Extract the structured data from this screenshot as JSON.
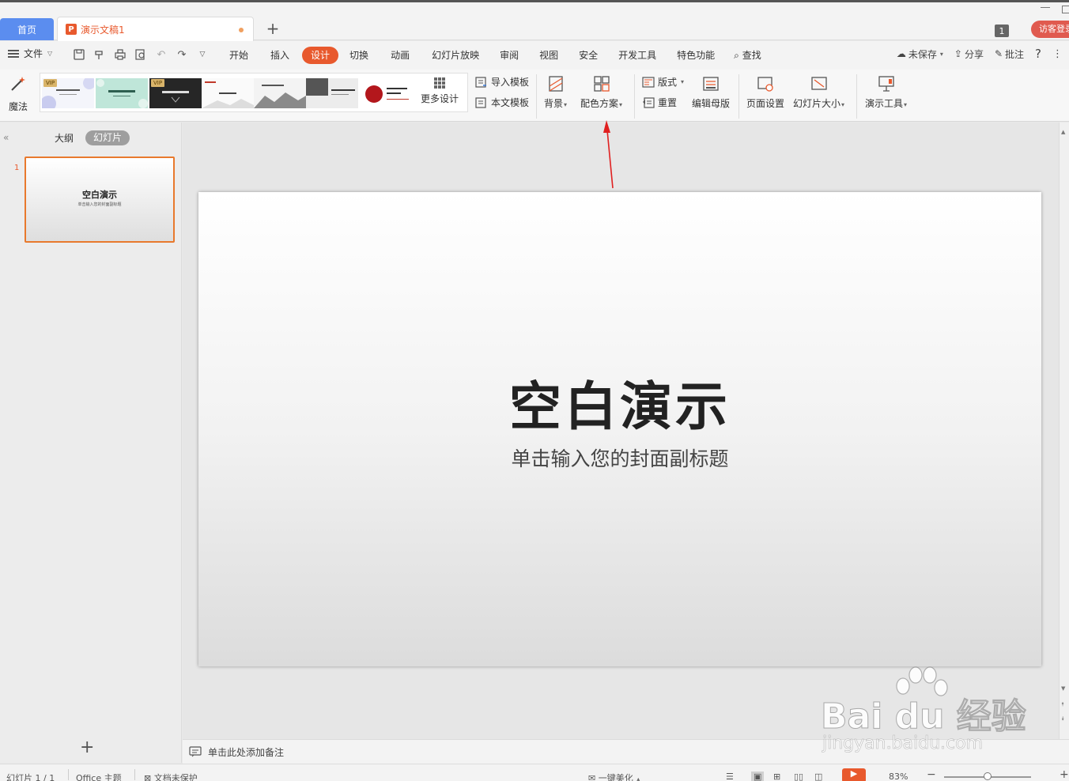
{
  "tabs": {
    "home": "首页",
    "doc": "演示文稿1"
  },
  "window": {
    "badge": "1",
    "visitor": "访客登录"
  },
  "menu": {
    "file": "文件",
    "tabs": [
      "开始",
      "插入",
      "设计",
      "切换",
      "动画",
      "幻灯片放映",
      "审阅",
      "视图",
      "安全",
      "开发工具",
      "特色功能"
    ],
    "active_tab": "设计",
    "search": "查找",
    "unsaved": "未保存",
    "share": "分享",
    "comment": "批注",
    "help": "?"
  },
  "ribbon": {
    "magic": "魔法",
    "vip": "VIP",
    "more_design": "更多设计",
    "import_template": "导入模板",
    "this_template": "本文模板",
    "background": "背景",
    "color_scheme": "配色方案",
    "layout": "版式",
    "reset": "重置",
    "edit_master": "编辑母版",
    "page_setup": "页面设置",
    "slide_size": "幻灯片大小",
    "present_tools": "演示工具"
  },
  "leftpanel": {
    "outline": "大纲",
    "slides": "幻灯片",
    "slide_number": "1",
    "thumb_title": "空白演示",
    "thumb_sub": "单击输入您的封面副标题",
    "add": "+"
  },
  "slide": {
    "title": "空白演示",
    "subtitle": "单击输入您的封面副标题"
  },
  "notes": {
    "placeholder": "单击此处添加备注"
  },
  "status": {
    "slide_count": "幻灯片 1 / 1",
    "theme": "Office 主题",
    "protect": "文档未保护",
    "beautify": "一键美化",
    "zoom": "83%"
  },
  "watermark": {
    "brand": "Bai du 经验",
    "url": "jingyan.baidu.com"
  },
  "colors": {
    "accent": "#e8592d",
    "home_tab": "#5b8def",
    "arrow": "#e02020"
  }
}
